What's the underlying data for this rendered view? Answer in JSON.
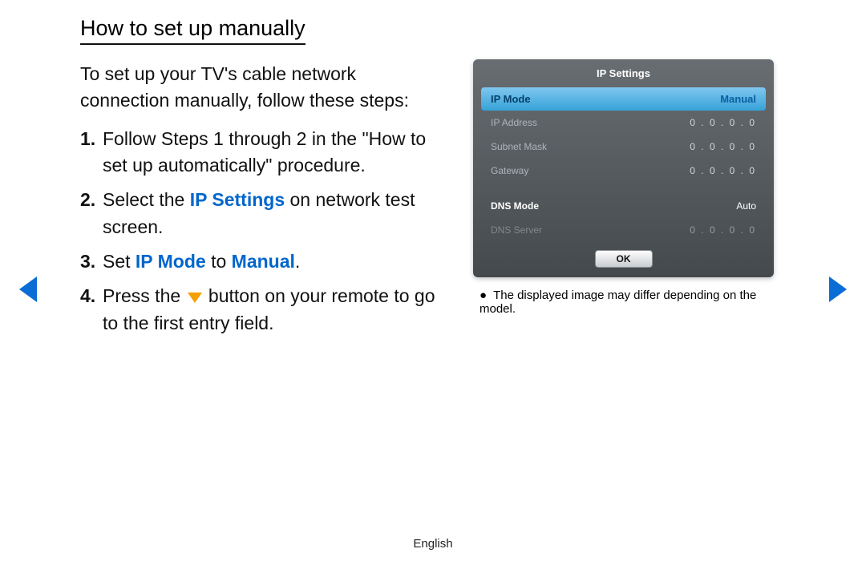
{
  "title": "How to set up manually",
  "intro": "To set up your TV's cable network connection manually, follow these steps:",
  "steps": {
    "s1_num": "1.",
    "s1_text": "Follow Steps 1 through 2 in the \"How to set up automatically\" procedure.",
    "s2_num": "2.",
    "s2_pre": "Select the ",
    "s2_hl": "IP Settings",
    "s2_post": " on network test screen.",
    "s3_num": "3.",
    "s3_pre": "Set ",
    "s3_hl1": "IP Mode",
    "s3_mid": " to ",
    "s3_hl2": "Manual",
    "s3_post": ".",
    "s4_num": "4.",
    "s4_pre": "Press the ",
    "s4_post": " button on your remote to go to the first entry field."
  },
  "panel": {
    "title": "IP Settings",
    "row_hl_label": "IP Mode",
    "row_hl_value": "Manual",
    "rows": [
      {
        "label": "IP Address",
        "value": "0 . 0 . 0 . 0"
      },
      {
        "label": "Subnet Mask",
        "value": "0 . 0 . 0 . 0"
      },
      {
        "label": "Gateway",
        "value": "0 . 0 . 0 . 0"
      }
    ],
    "row_dns_mode_label": "DNS Mode",
    "row_dns_mode_value": "Auto",
    "row_dns_server_label": "DNS Server",
    "row_dns_server_value": "0 . 0 . 0 . 0",
    "ok": "OK"
  },
  "disclaimer": "The displayed image may differ depending on the model.",
  "footer": "English"
}
